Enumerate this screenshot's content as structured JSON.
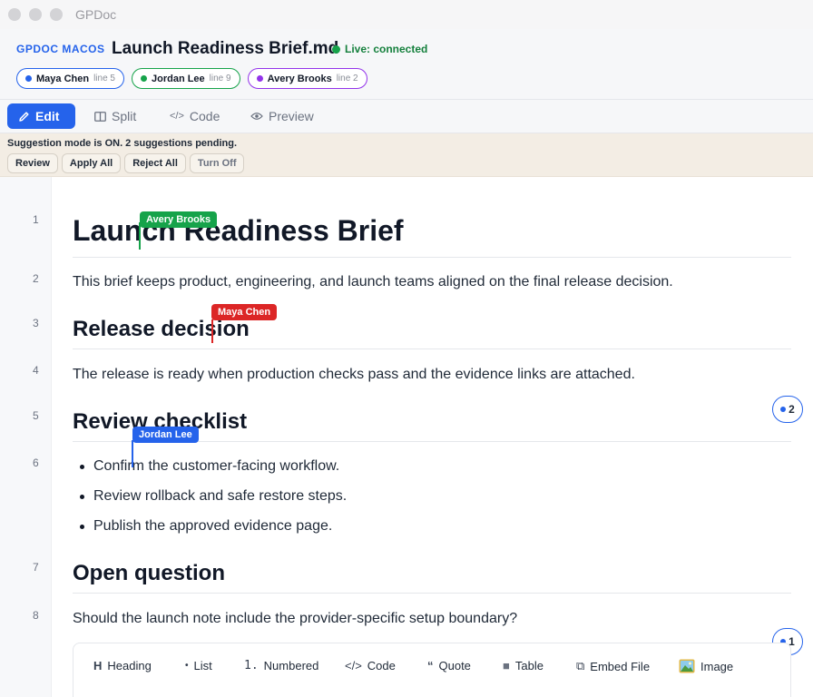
{
  "window": {
    "title": "GPDoc"
  },
  "header": {
    "brand": "GPDOC MACOS",
    "doc_title": "Launch Readiness Brief.md",
    "live_status": "Live: connected",
    "presence": [
      {
        "name": "Maya Chen",
        "line": "line 5"
      },
      {
        "name": "Jordan Lee",
        "line": "line 9"
      },
      {
        "name": "Avery Brooks",
        "line": "line 2"
      }
    ]
  },
  "modes": [
    {
      "label": "Edit",
      "icon": "pencil-icon"
    },
    {
      "label": "Split",
      "icon": "split-icon"
    },
    {
      "label": "Code",
      "icon": "code-icon"
    },
    {
      "label": "Preview",
      "icon": "eye-icon"
    }
  ],
  "suggestion_bar": {
    "message": "Suggestion mode is ON. 2 suggestions pending.",
    "buttons": [
      "Review",
      "Apply All",
      "Reject All",
      "Turn Off"
    ]
  },
  "gutter": {
    "line_numbers": [
      "1",
      "2",
      "3",
      "4",
      "5",
      "6",
      "7",
      "8"
    ]
  },
  "document": {
    "h1": "Launch Readiness Brief",
    "intro": "This brief keeps product, engineering, and launch teams aligned on the final release decision.",
    "h2_release": "Release decision",
    "release_text": "The release is ready when production checks pass and the evidence links are attached.",
    "h2_checklist": "Review checklist",
    "checklist": [
      "Confirm the customer-facing workflow.",
      "Review rollback and safe restore steps.",
      "Publish the approved evidence page."
    ],
    "h2_question": "Open question",
    "question_text": "Should the launch note include the provider-specific setup boundary?"
  },
  "cursors": [
    {
      "name": "Avery Brooks",
      "color": "#16a34a"
    },
    {
      "name": "Maya Chen",
      "color": "#dc2626"
    },
    {
      "name": "Jordan Lee",
      "color": "#2563eb"
    }
  ],
  "comment_badges": [
    "2",
    "1"
  ],
  "insert_toolbar": [
    {
      "icon": "H",
      "label": "Heading"
    },
    {
      "icon": "•",
      "label": "List"
    },
    {
      "icon": "1.",
      "label": "Numbered"
    },
    {
      "icon": "</>",
      "label": "Code"
    },
    {
      "icon": "“",
      "label": "Quote"
    },
    {
      "icon": "■",
      "label": "Table"
    },
    {
      "icon": "⧉",
      "label": "Embed File"
    },
    {
      "icon": "image-icon",
      "label": "Image"
    }
  ],
  "colors": {
    "accent": "#2563eb",
    "live": "#16a34a",
    "suggestion_bg": "#f3ede4"
  }
}
